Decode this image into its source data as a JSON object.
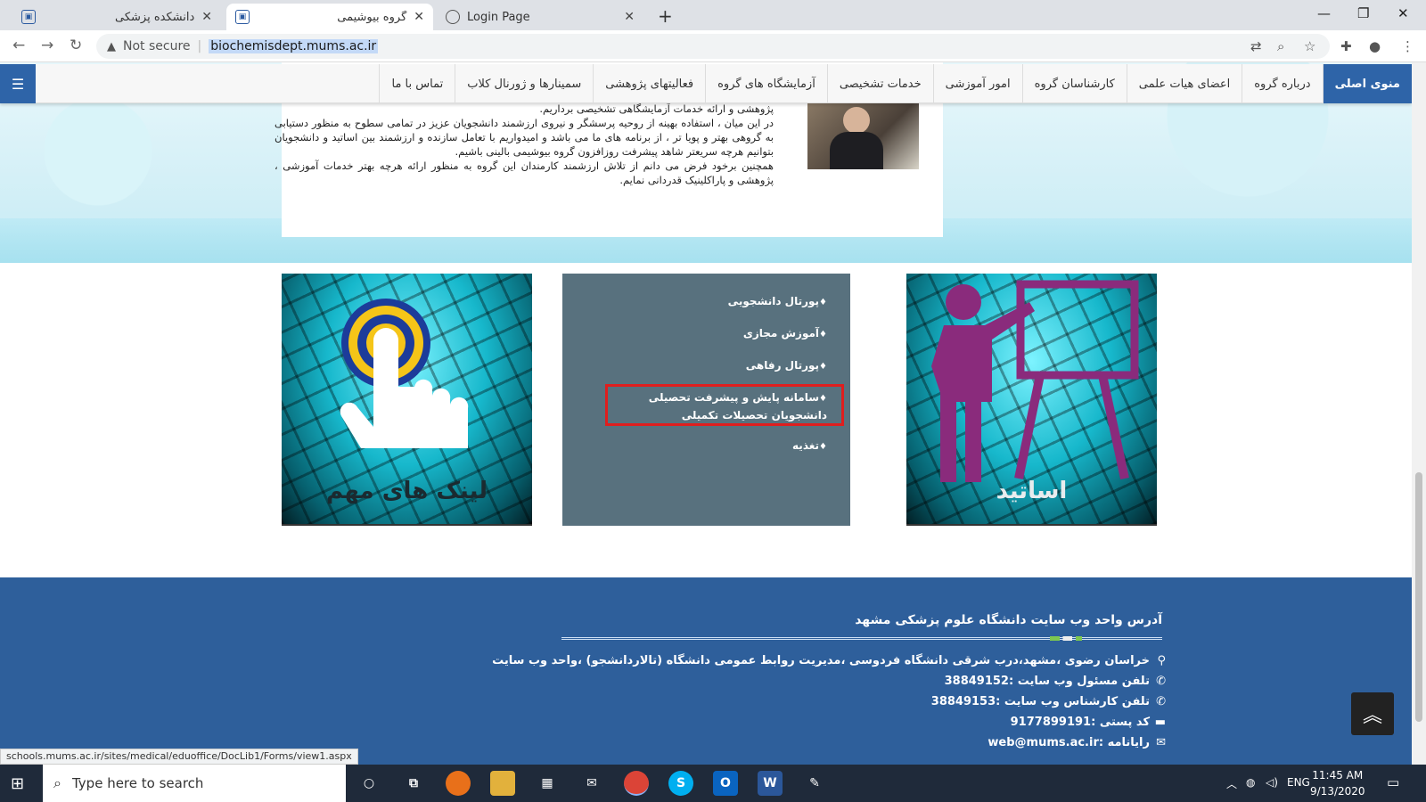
{
  "browser": {
    "tabs": [
      {
        "title": "دانشکده پزشکی",
        "active": false
      },
      {
        "title": "گروه بیوشیمی",
        "active": true
      },
      {
        "title": "Login Page",
        "active": false
      }
    ],
    "security_label": "Not secure",
    "url": "biochemisdept.mums.ac.ir"
  },
  "nav": {
    "items": [
      "منوی اصلی",
      "درباره گروه",
      "اعضای هیات علمی",
      "کارشناسان گروه",
      "امور آموزشی",
      "خدمات تشخیصی",
      "آزمایشگاه های گروه",
      "فعالیتهای پژوهشی",
      "سمینارها و ژورنال کلاب",
      "تماس با ما"
    ]
  },
  "intro": {
    "lines": [
      "پژوهشی و ارائه خدمات آزمایشگاهی تشخیصی برداریم.",
      "در این میان ، استفاده بهینه از روحیه پرسشگر و نیروی ارزشمند دانشجویان عزیز در تمامی سطوح به منظور دستیابی به گروهی بهتر و پویا تر ، از برنامه های ما می باشد و امیدواریم با تعامل سازنده و ارزشمند بین اساتید و دانشجویان بتوانیم هرچه سریعتر شاهد پیشرفت روزافزون گروه بیوشیمی بالینی باشیم.",
      "همچنین برخود فرض می دانم از تلاش ارزشمند کارمندان این گروه به منظور ارائه هرچه بهتر خدمات آموزشی ، پژوهشی و پاراکلینیک قدردانی نمایم."
    ]
  },
  "tiles": {
    "links_caption": "لینک های مهم",
    "professors_caption": "اساتید",
    "links": [
      "پورتال دانشجویی",
      "آموزش مجازی",
      "پورتال رفاهی",
      "سامانه پایش و پیشرفت تحصیلی دانشجویان تحصیلات تکمیلی",
      "تغذیه"
    ]
  },
  "footer": {
    "heading": "آدرس واحد وب سایت دانشگاه علوم پزشکی مشهد",
    "address": "خراسان رضوی ،مشهد،درب شرقی دانشگاه فردوسی ،مدیریت روابط عمومی دانشگاه (تالاردانشجو) ،واحد وب سایت",
    "phone_manager": "تلفن مسئول وب سایت :38849152",
    "phone_expert": "تلفن کارشناس وب سایت :38849153",
    "postal": "کد پستی :9177899191",
    "email": "رایانامه :web@mums.ac.ir"
  },
  "status_url": "schools.mums.ac.ir/sites/medical/eduoffice/DocLib1/Forms/view1.aspx",
  "taskbar": {
    "search_placeholder": "Type here to search",
    "lang": "ENG",
    "time": "11:45 AM",
    "date": "9/13/2020"
  }
}
